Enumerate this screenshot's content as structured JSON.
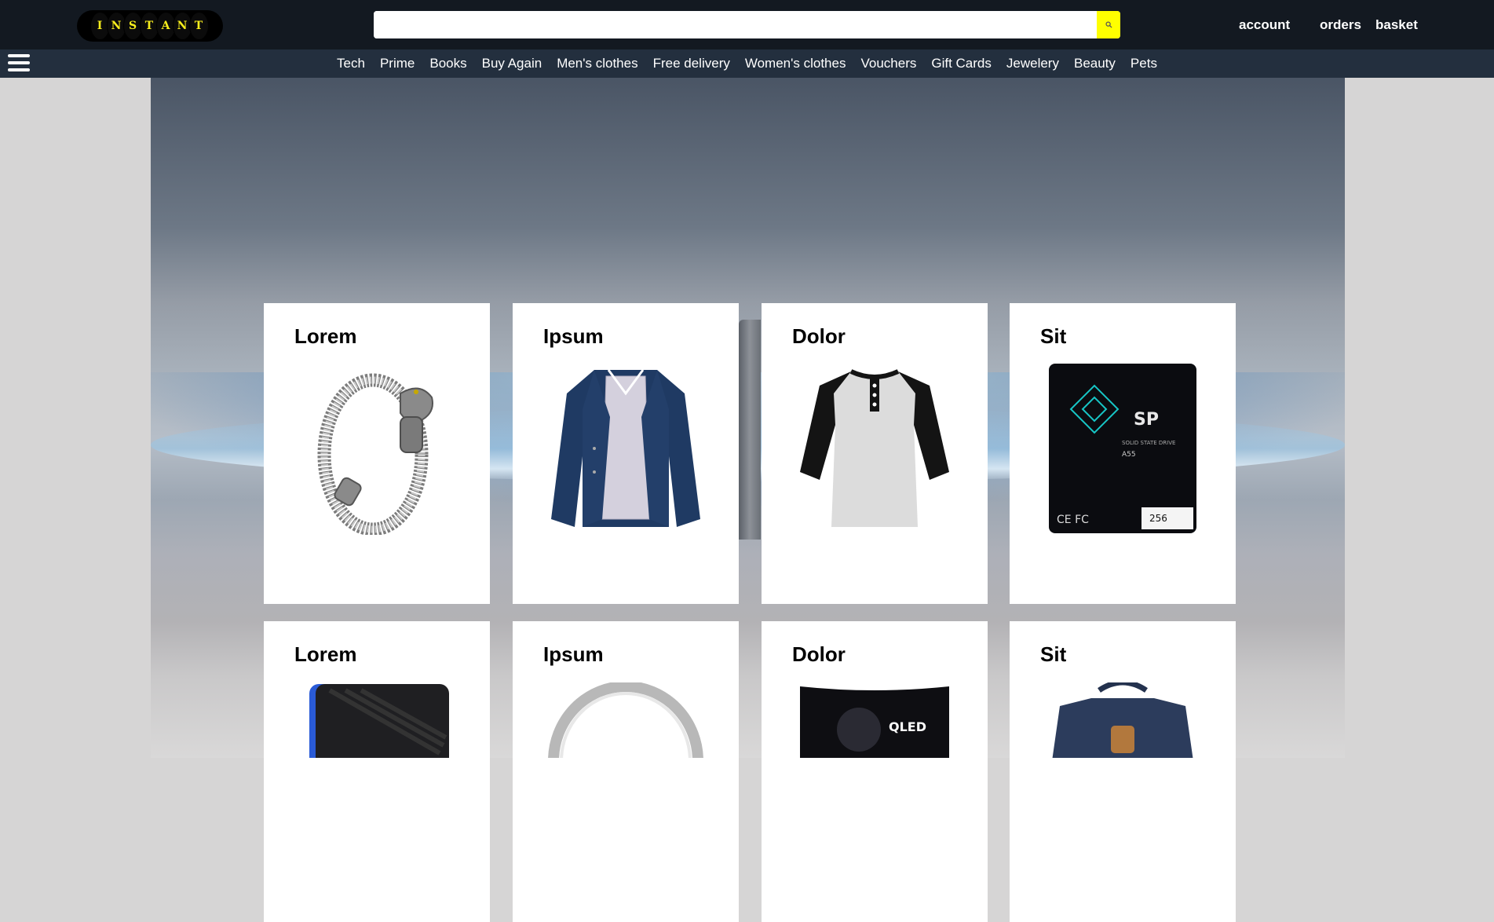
{
  "header": {
    "logo_letters": [
      "I",
      "N",
      "S",
      "T",
      "A",
      "N",
      "T"
    ],
    "search": {
      "value": "",
      "placeholder": ""
    },
    "links": {
      "account": "account",
      "orders": "orders",
      "basket": "basket"
    }
  },
  "nav": {
    "items": [
      "Tech",
      "Prime",
      "Books",
      "Buy Again",
      "Men's clothes",
      "Free delivery",
      "Women's clothes",
      "Vouchers",
      "Gift Cards",
      "Jewelery",
      "Beauty",
      "Pets"
    ]
  },
  "products": {
    "row1": [
      {
        "title": "Lorem",
        "image": "silver-dragon-bracelet"
      },
      {
        "title": "Ipsum",
        "image": "navy-jacket"
      },
      {
        "title": "Dolor",
        "image": "raglan-henley-shirt"
      },
      {
        "title": "Sit",
        "image": "ssd-256gb"
      }
    ],
    "row2": [
      {
        "title": "Lorem",
        "image": "external-hard-drive"
      },
      {
        "title": "Ipsum",
        "image": "silver-ring"
      },
      {
        "title": "Dolor",
        "image": "curved-gaming-monitor"
      },
      {
        "title": "Sit",
        "image": "navy-backpack"
      }
    ]
  },
  "colors": {
    "topbar": "#131921",
    "navbar": "#232f3e",
    "accent": "#ffff00",
    "logo_text": "#f7ee1c"
  }
}
